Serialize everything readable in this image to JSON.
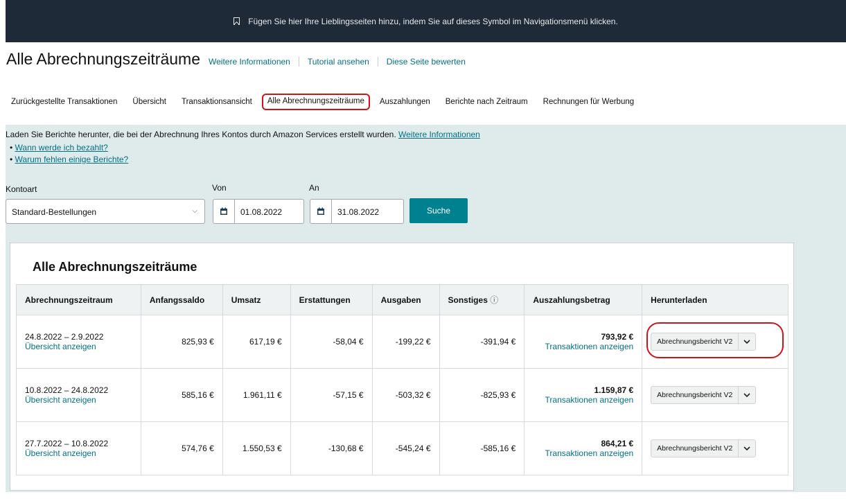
{
  "banner": {
    "text": "Fügen Sie hier Ihre Lieblingsseiten hinzu, indem Sie auf dieses Symbol im Navigationsmenü klicken."
  },
  "header": {
    "title": "Alle Abrechnungszeiträume",
    "links": [
      "Weitere Informationen",
      "Tutorial ansehen",
      "Diese Seite bewerten"
    ]
  },
  "tabs": [
    "Zurückgestellte Transaktionen",
    "Übersicht",
    "Transaktionsansicht",
    "Alle Abrechnungszeiträume",
    "Auszahlungen",
    "Berichte nach Zeitraum",
    "Rechnungen für Werbung"
  ],
  "info": {
    "text": "Laden Sie Berichte herunter, die bei der Abrechnung Ihres Kontos durch Amazon Services erstellt wurden.",
    "link": "Weitere Informationen",
    "bullets": [
      "Wann werde ich bezahlt?",
      "Warum fehlen einige Berichte?"
    ]
  },
  "filters": {
    "account_label": "Kontoart",
    "account_value": "Standard-Bestellungen",
    "from_label": "Von",
    "from_value": "01.08.2022",
    "to_label": "An",
    "to_value": "31.08.2022",
    "search_label": "Suche"
  },
  "table": {
    "title": "Alle Abrechnungszeiträume",
    "headers": [
      "Abrechnungszeitraum",
      "Anfangssaldo",
      "Umsatz",
      "Erstattungen",
      "Ausgaben",
      "Sonstiges",
      "Auszahlungsbetrag",
      "Herunterladen"
    ],
    "rows": [
      {
        "period": "24.8.2022 – 2.9.2022",
        "view": "Übersicht anzeigen",
        "start": "825,93 €",
        "sales": "617,19 €",
        "refunds": "-58,04 €",
        "expenses": "-199,22 €",
        "other": "-391,94 €",
        "payout": "793,92 €",
        "tx": "Transaktionen anzeigen",
        "download": "Abrechnungsbericht V2"
      },
      {
        "period": "10.8.2022 – 24.8.2022",
        "view": "Übersicht anzeigen",
        "start": "585,16 €",
        "sales": "1.961,11 €",
        "refunds": "-57,15 €",
        "expenses": "-503,32 €",
        "other": "-825,93 €",
        "payout": "1.159,87 €",
        "tx": "Transaktionen anzeigen",
        "download": "Abrechnungsbericht V2"
      },
      {
        "period": "27.7.2022 – 10.8.2022",
        "view": "Übersicht anzeigen",
        "start": "574,76 €",
        "sales": "1.550,53 €",
        "refunds": "-130,68 €",
        "expenses": "-545,24 €",
        "other": "-585,16 €",
        "payout": "864,21 €",
        "tx": "Transaktionen anzeigen",
        "download": "Abrechnungsbericht V2"
      }
    ]
  },
  "colors": {
    "link": "#007185",
    "highlight": "#d0121b",
    "button": "#00818f",
    "banner": "#1e2a38",
    "panel": "#dfeaea"
  },
  "icons": [
    "bookmark-icon",
    "calendar-icon",
    "chevron-down-icon",
    "help-circle-icon"
  ]
}
